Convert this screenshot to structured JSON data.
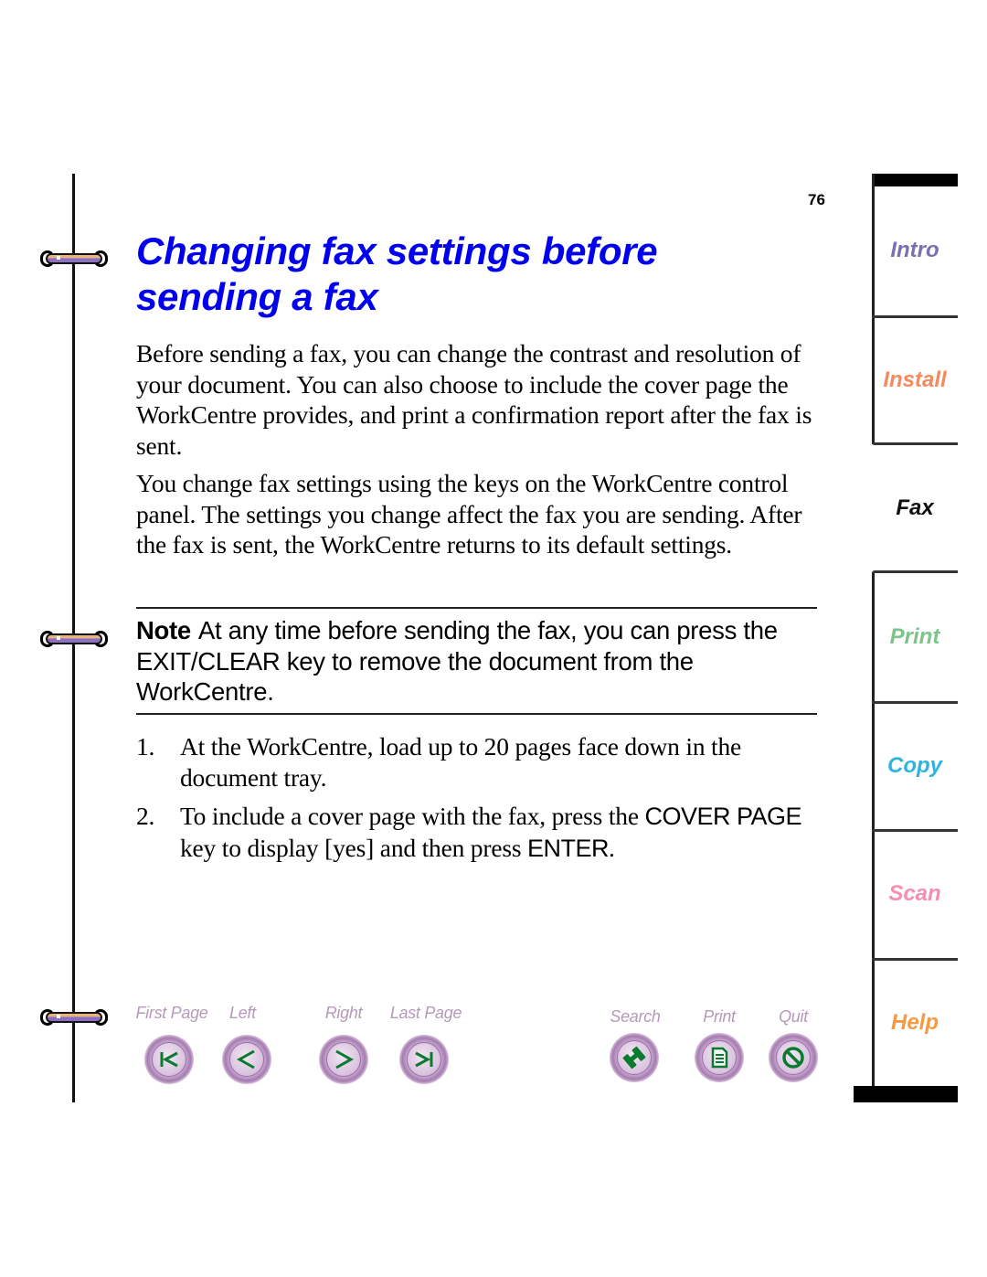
{
  "page": {
    "number": "76",
    "title": "Changing fax settings before sending a fax",
    "title_color": "#0000ee",
    "paragraphs": [
      "Before sending a fax, you can change the contrast and resolution of your document. You can also choose to include the cover page the WorkCentre provides, and print a confirmation report after the fax is sent.",
      "You change fax settings using the keys on the WorkCentre control panel. The settings you change affect the fax you are sending. After the fax is sent, the WorkCentre returns to its default settings."
    ],
    "note": {
      "label": "Note",
      "text": "At any time before sending the fax, you can press the EXIT/CLEAR key to remove the document from the WorkCentre."
    },
    "steps": [
      {
        "number": "1.",
        "text": "At the WorkCentre, load up to 20 pages face down in the document tray."
      },
      {
        "number": "2.",
        "text_before": "To include a cover page with the fax, press the ",
        "key1": "COVER PAGE",
        "text_middle": " key to display [yes] and then press ",
        "key2": "ENTER",
        "text_after": "."
      }
    ]
  },
  "nav": {
    "buttons": [
      {
        "id": "first-page",
        "label": "First Page",
        "icon": "first-page-icon"
      },
      {
        "id": "left",
        "label": "Left",
        "icon": "arrow-left-icon"
      },
      {
        "id": "right",
        "label": "Right",
        "icon": "arrow-right-icon"
      },
      {
        "id": "last-page",
        "label": "Last Page",
        "icon": "last-page-icon"
      },
      {
        "id": "search",
        "label": "Search",
        "icon": "binoculars-icon"
      },
      {
        "id": "print",
        "label": "Print",
        "icon": "document-icon"
      },
      {
        "id": "quit",
        "label": "Quit",
        "icon": "no-entry-icon"
      }
    ],
    "label_color": "#b59ab8",
    "icon_color": "#0a7a2e"
  },
  "tabs": {
    "items": [
      {
        "label": "Intro",
        "color": "#7a6fb0",
        "active": false
      },
      {
        "label": "Install",
        "color": "#f58a5e",
        "active": false
      },
      {
        "label": "Fax",
        "color": "#111111",
        "active": true
      },
      {
        "label": "Print",
        "color": "#7cc48a",
        "active": false
      },
      {
        "label": "Copy",
        "color": "#2fb4e0",
        "active": false
      },
      {
        "label": "Scan",
        "color": "#f48fb1",
        "active": false
      },
      {
        "label": "Help",
        "color": "#f59a42",
        "active": false
      }
    ]
  }
}
